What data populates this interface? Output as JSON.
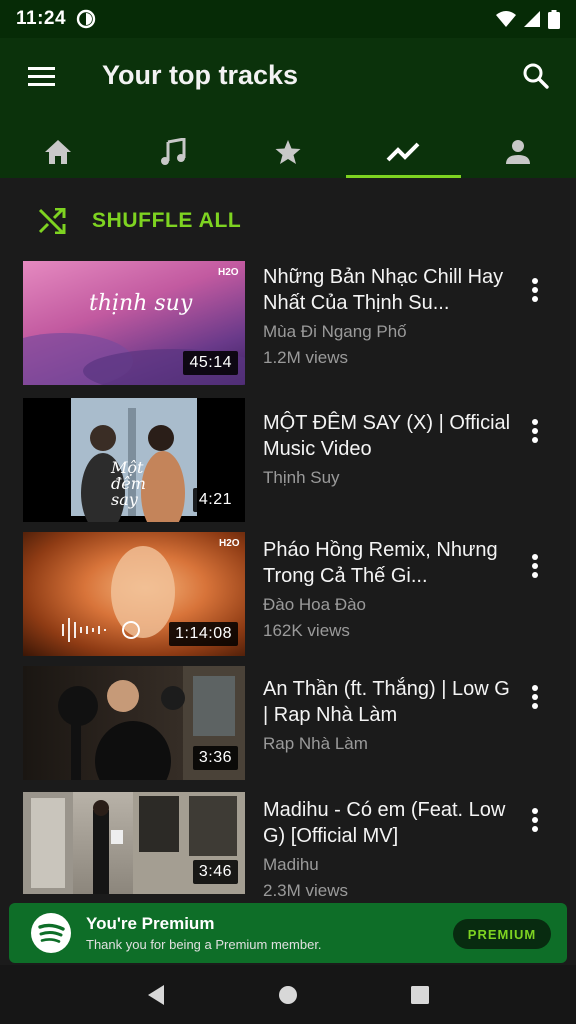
{
  "status_bar": {
    "time": "11:24"
  },
  "app_bar": {
    "title": "Your top tracks"
  },
  "tabs": [
    {
      "icon": "home-icon"
    },
    {
      "icon": "music-note-icon"
    },
    {
      "icon": "star-icon"
    },
    {
      "icon": "trending-icon",
      "active": true
    },
    {
      "icon": "person-icon"
    }
  ],
  "shuffle": {
    "label": "SHUFFLE ALL"
  },
  "tracks": [
    {
      "title": "Những Bản Nhạc Chill Hay Nhất Của Thịnh Su...",
      "subtitle": "Mùa Đi Ngang Phố",
      "views": "1.2M views",
      "duration": "45:14",
      "thumb_text": "thịnh suy"
    },
    {
      "title": "MỘT ĐÊM SAY (X) | Official Music Video",
      "subtitle": "Thịnh Suy",
      "views": "",
      "duration": "4:21",
      "thumb_text": "Một đêm say"
    },
    {
      "title": "Pháo Hồng Remix, Nhưng Trong Cả Thế Gi...",
      "subtitle": "Đào Hoa Đào",
      "views": "162K views",
      "duration": "1:14:08",
      "thumb_text": "H2O"
    },
    {
      "title": "An Thần (ft. Thắng) | Low G | Rap Nhà Làm",
      "subtitle": "Rap Nhà Làm",
      "views": "",
      "duration": "3:36",
      "thumb_text": ""
    },
    {
      "title": "Madihu - Có em (Feat. Low G) [Official MV]",
      "subtitle": "Madihu",
      "views": "2.3M views",
      "duration": "3:46",
      "thumb_text": ""
    }
  ],
  "premium": {
    "title": "You're Premium",
    "subtitle": "Thank you for being a Premium member.",
    "button": "PREMIUM"
  },
  "colors": {
    "accent": "#7ed321",
    "app_bar": "#0b320b",
    "background": "#1b1b1b",
    "banner": "#0e6e28"
  }
}
